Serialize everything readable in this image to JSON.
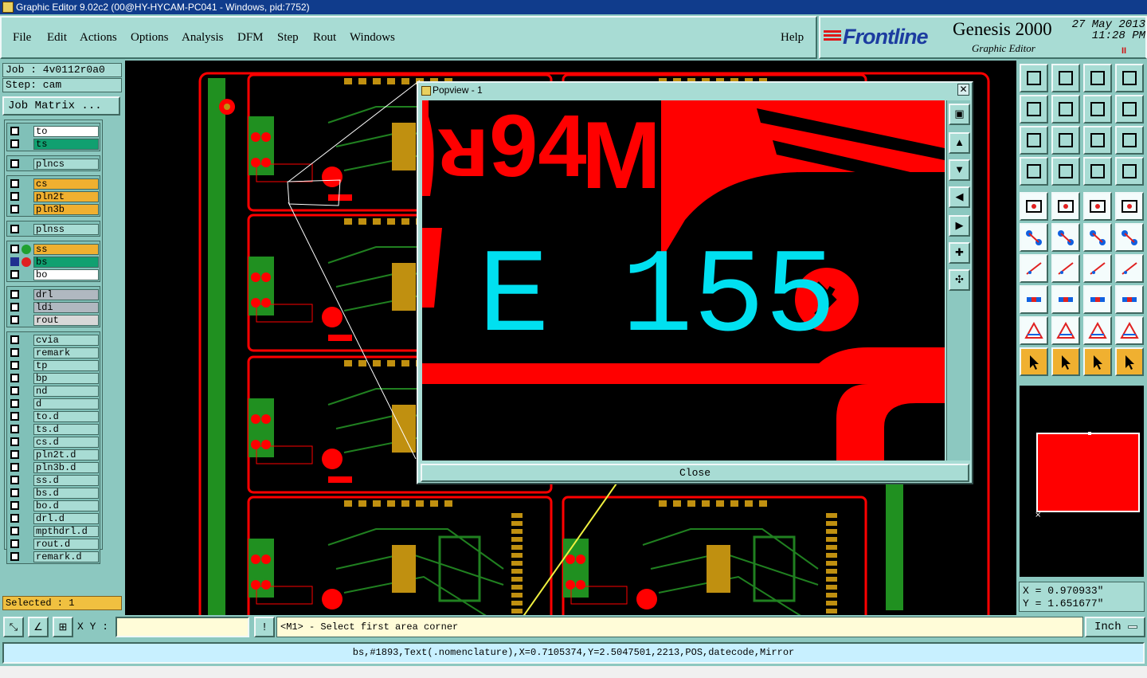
{
  "window": {
    "title": "Graphic Editor 9.02c2 (00@HY-HYCAM-PC041 - Windows, pid:7752)"
  },
  "menu": {
    "file": "File",
    "edit": "Edit",
    "actions": "Actions",
    "options": "Options",
    "analysis": "Analysis",
    "dfm": "DFM",
    "step": "Step",
    "rout": "Rout",
    "windows": "Windows",
    "help": "Help"
  },
  "brand": {
    "logo": "Frontline",
    "product": "Genesis 2000",
    "subtitle": "Graphic Editor",
    "date": "27 May 2013",
    "time": "11:28 PM",
    "pause": "II"
  },
  "job": {
    "job_label": "Job : 4v0112r0a0",
    "step_label": "Step: cam",
    "matrix_button": "Job Matrix ..."
  },
  "layers": [
    {
      "name": "to",
      "color": "#ffffff",
      "active": false,
      "dot": ""
    },
    {
      "name": "ts",
      "color": "#10a070",
      "active": false,
      "dot": ""
    },
    {
      "name": "plncs",
      "color": "#a8dcd4",
      "active": false,
      "dot": ""
    },
    {
      "name": "cs",
      "color": "#f0b030",
      "active": false,
      "dot": ""
    },
    {
      "name": "pln2t",
      "color": "#f0b030",
      "active": false,
      "dot": ""
    },
    {
      "name": "pln3b",
      "color": "#f0b030",
      "active": false,
      "dot": ""
    },
    {
      "name": "plnss",
      "color": "#a8dcd4",
      "active": false,
      "dot": ""
    },
    {
      "name": "ss",
      "color": "#f0b030",
      "active": false,
      "dot": "#20a030"
    },
    {
      "name": "bs",
      "color": "#10a070",
      "active": true,
      "dot": "#e02020"
    },
    {
      "name": "bo",
      "color": "#ffffff",
      "active": false,
      "dot": ""
    },
    {
      "name": "drl",
      "color": "#b0b8c0",
      "active": false,
      "dot": ""
    },
    {
      "name": "ldi",
      "color": "#b0b8c0",
      "active": false,
      "dot": ""
    },
    {
      "name": "rout",
      "color": "#d8d8d8",
      "active": false,
      "dot": ""
    },
    {
      "name": "cvia",
      "color": "#a8dcd4",
      "active": false,
      "dot": ""
    },
    {
      "name": "remark",
      "color": "#a8dcd4",
      "active": false,
      "dot": ""
    },
    {
      "name": "tp",
      "color": "#a8dcd4",
      "active": false,
      "dot": ""
    },
    {
      "name": "bp",
      "color": "#a8dcd4",
      "active": false,
      "dot": ""
    },
    {
      "name": "nd",
      "color": "#a8dcd4",
      "active": false,
      "dot": ""
    },
    {
      "name": "d",
      "color": "#a8dcd4",
      "active": false,
      "dot": ""
    },
    {
      "name": "to.d",
      "color": "#a8dcd4",
      "active": false,
      "dot": ""
    },
    {
      "name": "ts.d",
      "color": "#a8dcd4",
      "active": false,
      "dot": ""
    },
    {
      "name": "cs.d",
      "color": "#a8dcd4",
      "active": false,
      "dot": ""
    },
    {
      "name": "pln2t.d",
      "color": "#a8dcd4",
      "active": false,
      "dot": ""
    },
    {
      "name": "pln3b.d",
      "color": "#a8dcd4",
      "active": false,
      "dot": ""
    },
    {
      "name": "ss.d",
      "color": "#a8dcd4",
      "active": false,
      "dot": ""
    },
    {
      "name": "bs.d",
      "color": "#a8dcd4",
      "active": false,
      "dot": ""
    },
    {
      "name": "bo.d",
      "color": "#a8dcd4",
      "active": false,
      "dot": ""
    },
    {
      "name": "drl.d",
      "color": "#a8dcd4",
      "active": false,
      "dot": ""
    },
    {
      "name": "mpthdrl.d",
      "color": "#a8dcd4",
      "active": false,
      "dot": ""
    },
    {
      "name": "rout.d",
      "color": "#a8dcd4",
      "active": false,
      "dot": ""
    },
    {
      "name": "remark.d",
      "color": "#a8dcd4",
      "active": false,
      "dot": ""
    }
  ],
  "selected": "Selected : 1",
  "popview": {
    "title": "Popview - 1",
    "close_button": "Close",
    "close_x": "✕",
    "zoom_text": "E 155"
  },
  "coords": {
    "x": "X = 0.970933\"",
    "y": "Y = 1.651677\""
  },
  "bottom": {
    "xy_label": "X Y :",
    "xy_value": "",
    "prompt": "<M1> - Select first area corner",
    "unit": "Inch"
  },
  "status_line": "bs,#1893,Text(.nomenclature),X=0.7105374,Y=2.5047501,2213,POS,datecode,Mirror",
  "colors": {
    "accent": "#a8dcd4",
    "panel": "#8cc8c0",
    "copper": "#ff0000",
    "silk": "#00e0f0",
    "pad": "#c09010",
    "trace": "#208020"
  }
}
